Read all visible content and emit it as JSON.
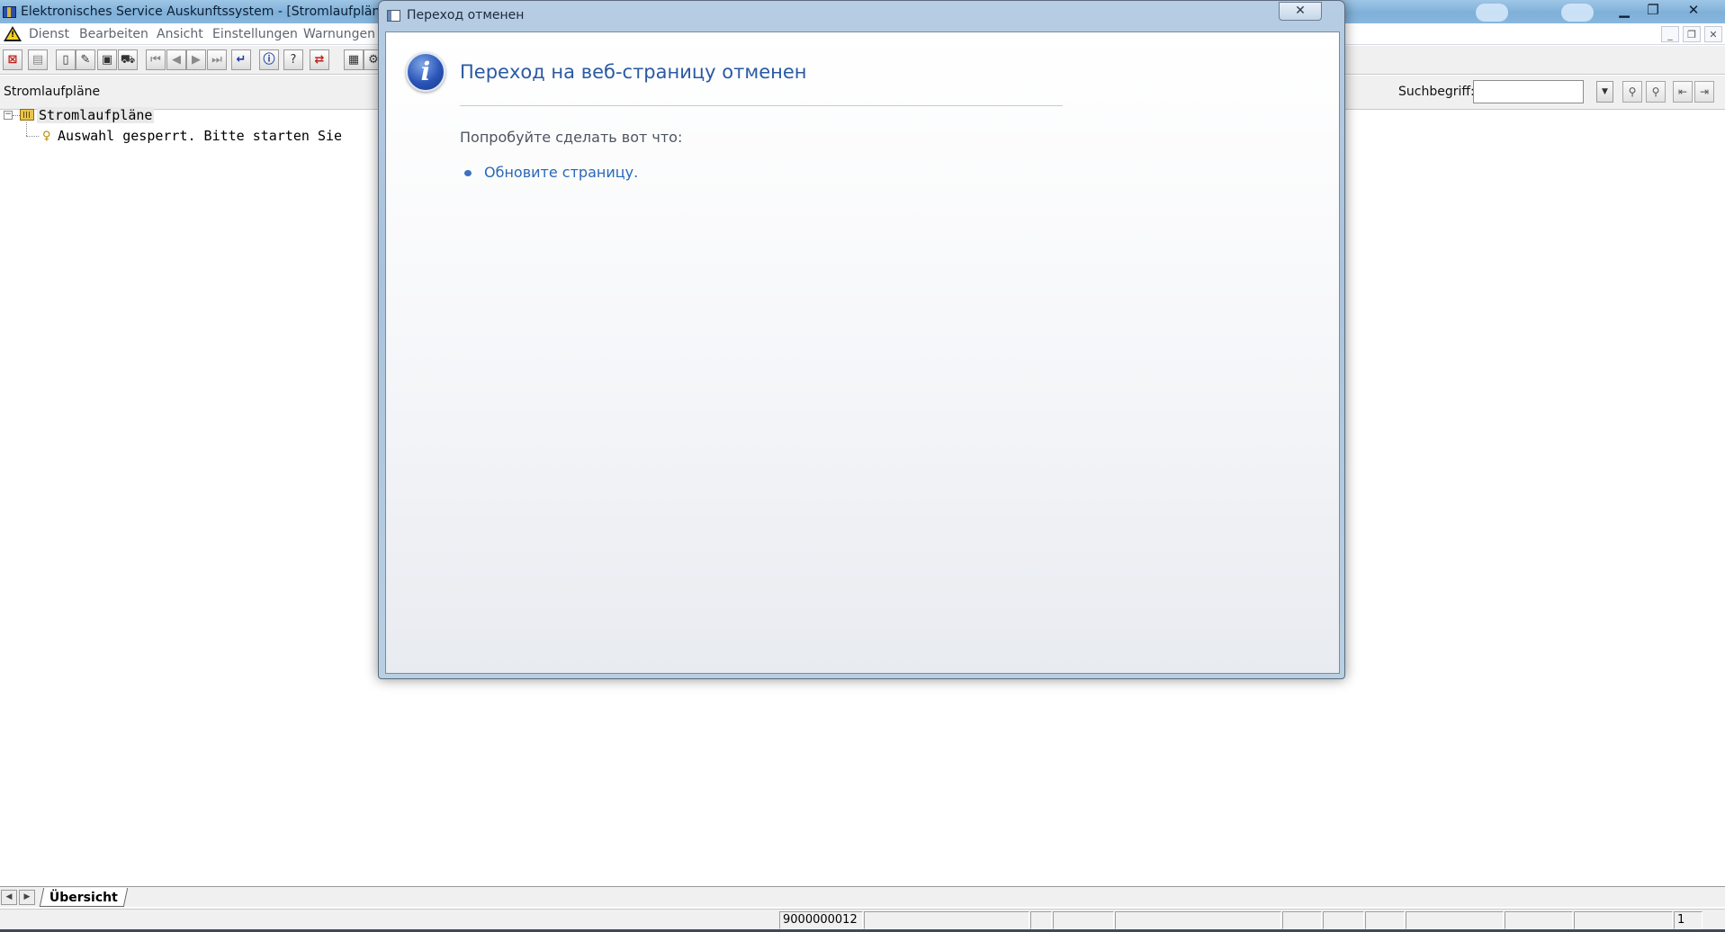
{
  "app": {
    "title": "Elektronisches Service Auskunftssystem - [Stromlaufpläne]",
    "caption_min": "▁",
    "caption_max": "❐",
    "caption_close": "✕"
  },
  "menu": {
    "items": [
      "Dienst",
      "Bearbeiten",
      "Ansicht",
      "Einstellungen",
      "Warnungen"
    ],
    "mdi_min": "_",
    "mdi_restore": "❐",
    "mdi_close": "✕"
  },
  "pane": {
    "title": "Stromlaufpläne",
    "search_label": "Suchbegriff:",
    "search_value": ""
  },
  "tree": {
    "root_label": "Stromlaufpläne",
    "child_label": "Auswahl gesperrt. Bitte starten Sie"
  },
  "tabs": {
    "active": "Übersicht"
  },
  "status": {
    "cell_id": "9000000012",
    "page": "1"
  },
  "dialog": {
    "title": "Переход отменен",
    "close": "✕",
    "heading": "Переход на веб-страницу отменен",
    "suggestion": "Попробуйте сделать вот что:",
    "link": "Обновите страницу."
  },
  "colors": {
    "dialog_heading": "#2a5aa2",
    "link": "#2a67b8",
    "info_icon": "#2a55b8"
  }
}
